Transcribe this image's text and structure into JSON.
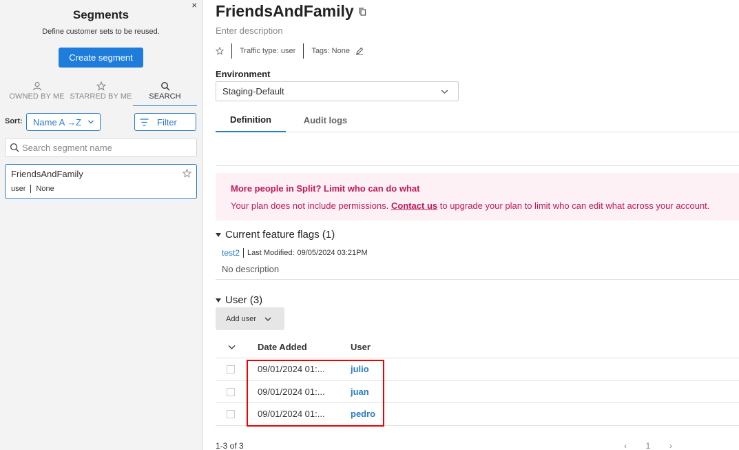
{
  "sidebar": {
    "close_label": "×",
    "title": "Segments",
    "subtitle": "Define customer sets to be reused.",
    "create_label": "Create segment",
    "tabs": [
      {
        "label": "OWNED BY ME",
        "icon": "person-icon"
      },
      {
        "label": "STARRED BY ME",
        "icon": "star-icon"
      },
      {
        "label": "SEARCH",
        "icon": "search-icon",
        "active": true
      }
    ],
    "sort_label": "Sort:",
    "sort_value": "Name A →Z",
    "filter_label": "Filter",
    "search_placeholder": "Search segment name",
    "segments": [
      {
        "name": "FriendsAndFamily",
        "traffic_type": "user",
        "tags": "None"
      }
    ]
  },
  "segment": {
    "name": "FriendsAndFamily",
    "description_placeholder": "Enter description",
    "traffic_type": "Traffic type: user",
    "tags": "Tags: None"
  },
  "environment": {
    "label": "Environment",
    "value": "Staging-Default"
  },
  "tabs": [
    {
      "label": "Definition",
      "active": true
    },
    {
      "label": "Audit logs",
      "active": false
    }
  ],
  "banner": {
    "title": "More people in Split? Limit who can do what",
    "text_before": "Your plan does not include permissions. ",
    "link": "Contact us",
    "text_after": " to upgrade your plan to limit who can edit what across your account."
  },
  "feature_flags": {
    "heading": "Current feature flags (1)",
    "items": [
      {
        "name": "test2",
        "last_modified_label": "Last Modified:",
        "last_modified": "09/05/2024 03:21PM",
        "description": "No description"
      }
    ]
  },
  "users": {
    "heading": "User (3)",
    "add_label": "Add user",
    "columns": [
      "Date Added",
      "User"
    ],
    "rows": [
      {
        "date": "09/01/2024 01:...",
        "user": "julio"
      },
      {
        "date": "09/01/2024 01:...",
        "user": "juan"
      },
      {
        "date": "09/01/2024 01:...",
        "user": "pedro"
      }
    ],
    "count_text": "1-3 of 3",
    "page": "1"
  },
  "colors": {
    "accent": "#1e7ddb",
    "banner_text": "#c2185b",
    "banner_bg": "#fdf1f5",
    "highlight": "#ee0000"
  }
}
